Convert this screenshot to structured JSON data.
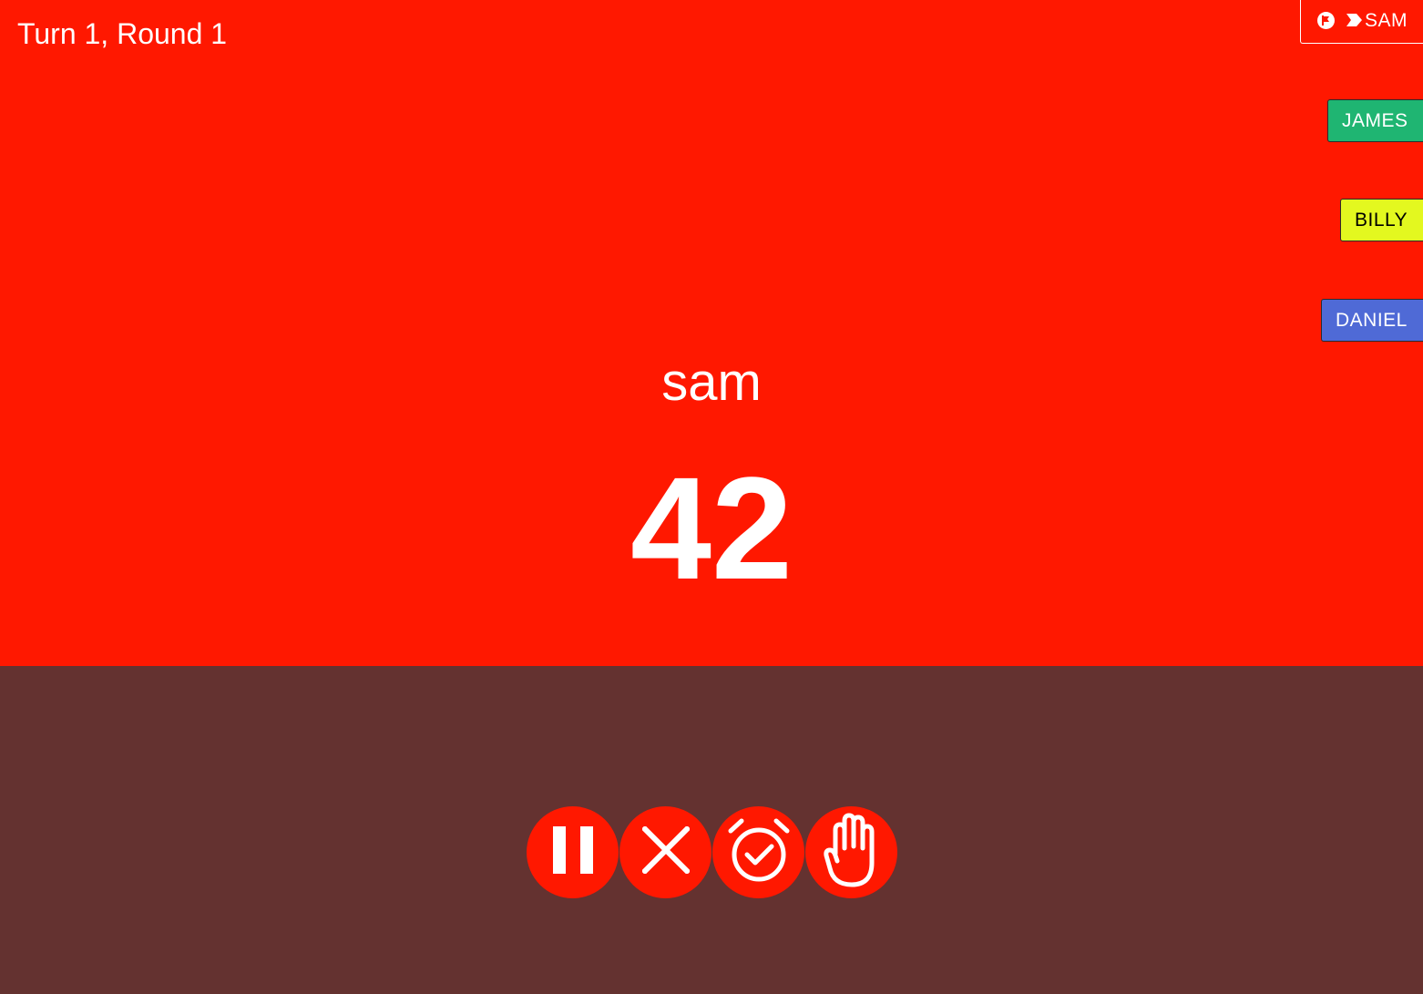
{
  "game": {
    "turn_label": "Turn 1, Round 1",
    "current_word": "sam",
    "timer_value": "42"
  },
  "players": {
    "current": "SAM",
    "list": [
      {
        "name": "JAMES",
        "color": "#1fb572"
      },
      {
        "name": "BILLY",
        "color": "#e3f81f"
      },
      {
        "name": "DANIEL",
        "color": "#4f6ad6"
      }
    ]
  },
  "controls": [
    {
      "icon": "pause-icon"
    },
    {
      "icon": "close-icon"
    },
    {
      "icon": "alarm-check-icon"
    },
    {
      "icon": "hand-icon"
    }
  ],
  "colors": {
    "top_background": "#ff1800",
    "bottom_background": "#643230",
    "accent": "#ff1800"
  }
}
